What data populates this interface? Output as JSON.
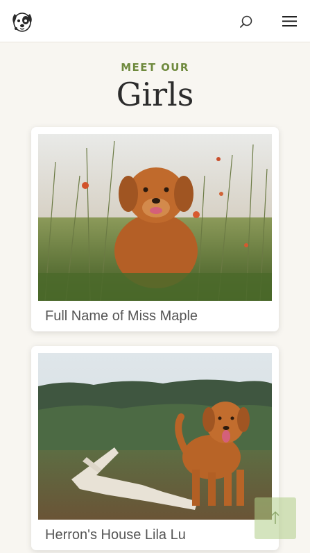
{
  "header": {
    "logo_icon": "dog-face-logo",
    "search_icon": "search-icon",
    "menu_icon": "hamburger-menu-icon"
  },
  "section": {
    "eyebrow": "MEET OUR",
    "title": "Girls"
  },
  "cards": [
    {
      "name": "Full Name of Miss Maple",
      "photo": "golden retriever dog sitting in tall grass with red flowers"
    },
    {
      "name": "Herron's House Lila Lu",
      "photo": "golden retriever dog standing in meadow beside driftwood"
    }
  ],
  "back_to_top": {
    "icon": "arrow-up-icon"
  },
  "colors": {
    "accent": "#6f8a3e",
    "background": "#f8f6f1",
    "button": "#b0ce88"
  }
}
